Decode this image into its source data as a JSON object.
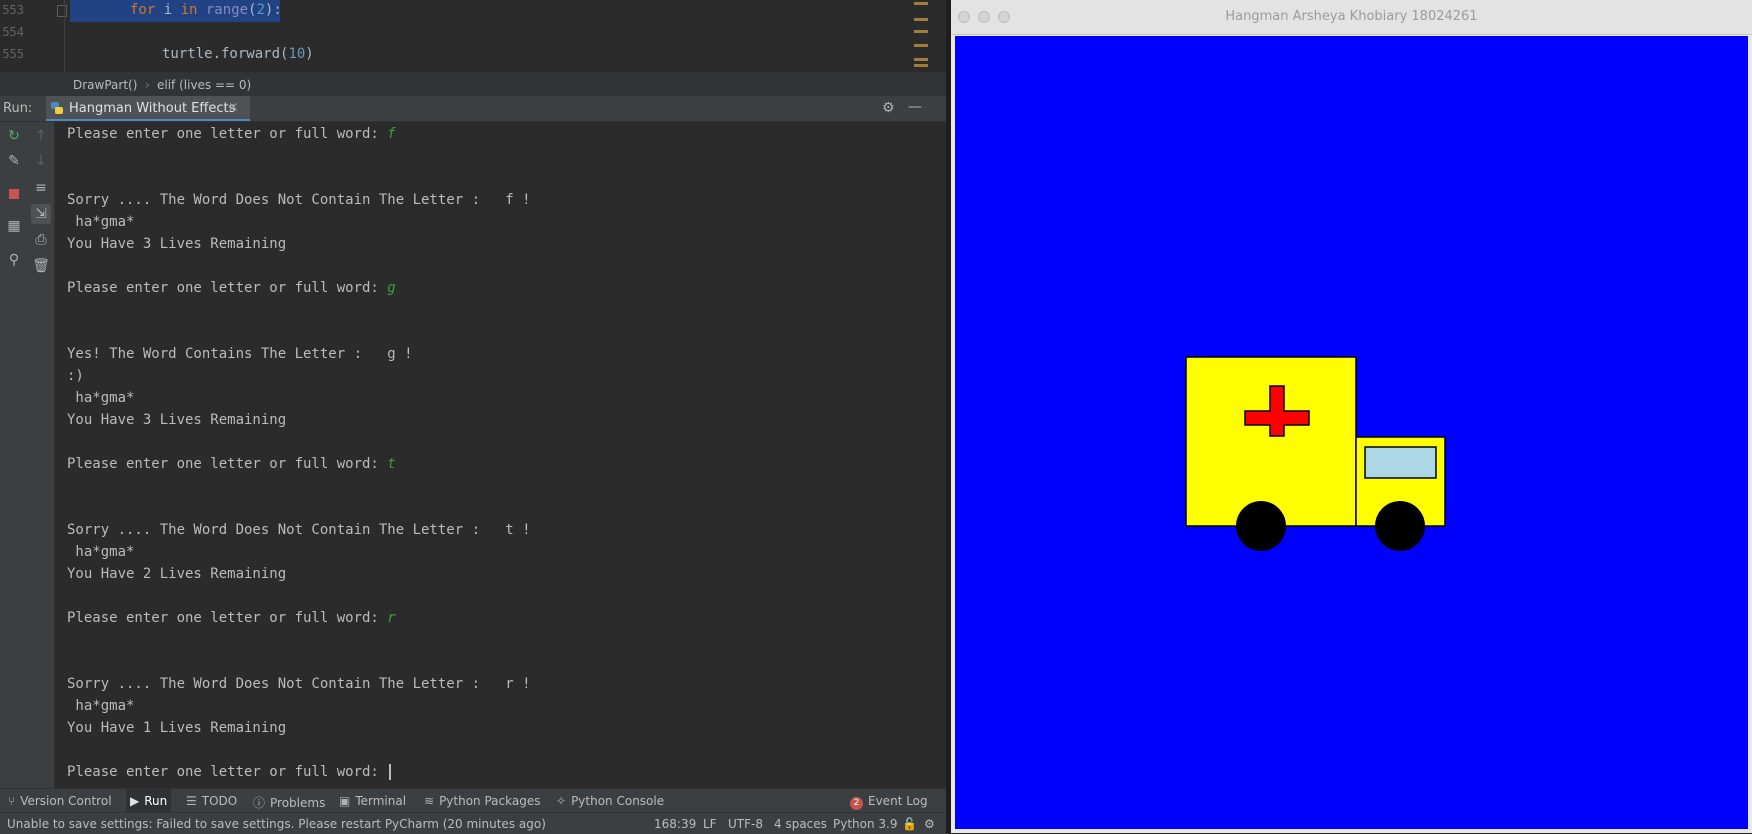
{
  "editor": {
    "gutter": [
      "553",
      "554",
      "555"
    ],
    "line1": {
      "indent": "for i in range",
      "kw_for": "for",
      "var": " i ",
      "kw_in": "in",
      "fn": " range",
      "paren_open": "(",
      "num": "2",
      "paren_close": "):"
    },
    "line3": {
      "text": "turtle.forward(",
      "num": "10",
      "close": ")"
    }
  },
  "breadcrumbs": [
    "DrawPart()",
    "elif (lives == 0)"
  ],
  "run_panel": {
    "label": "Run:",
    "tab_label": "Hangman Without Effects",
    "close": "×",
    "settings_icon": "⚙",
    "minimize_icon": "—"
  },
  "console": {
    "lines": [
      {
        "text": "Please enter one letter or full word: ",
        "input": "f"
      },
      {
        "text": ""
      },
      {
        "text": ""
      },
      {
        "text": "Sorry .... The Word Does Not Contain The Letter :   f !"
      },
      {
        "text": " ha*gma*"
      },
      {
        "text": "You Have 3 Lives Remaining"
      },
      {
        "text": ""
      },
      {
        "text": "Please enter one letter or full word: ",
        "input": "g"
      },
      {
        "text": ""
      },
      {
        "text": ""
      },
      {
        "text": "Yes! The Word Contains The Letter :   g !"
      },
      {
        "text": ":)"
      },
      {
        "text": " ha*gma*"
      },
      {
        "text": "You Have 3 Lives Remaining"
      },
      {
        "text": ""
      },
      {
        "text": "Please enter one letter or full word: ",
        "input": "t"
      },
      {
        "text": ""
      },
      {
        "text": ""
      },
      {
        "text": "Sorry .... The Word Does Not Contain The Letter :   t !"
      },
      {
        "text": " ha*gma*"
      },
      {
        "text": "You Have 2 Lives Remaining"
      },
      {
        "text": ""
      },
      {
        "text": "Please enter one letter or full word: ",
        "input": "r"
      },
      {
        "text": ""
      },
      {
        "text": ""
      },
      {
        "text": "Sorry .... The Word Does Not Contain The Letter :   r !"
      },
      {
        "text": " ha*gma*"
      },
      {
        "text": "You Have 1 Lives Remaining"
      },
      {
        "text": ""
      },
      {
        "text": "Please enter one letter or full word: ",
        "cursor": true
      }
    ]
  },
  "tool_windows": {
    "version_control": "Version Control",
    "run": "Run",
    "todo": "TODO",
    "problems": "Problems",
    "terminal": "Terminal",
    "python_packages": "Python Packages",
    "python_console": "Python Console",
    "event_log": "Event Log",
    "event_count": "2"
  },
  "status_bar": {
    "message": "Unable to save settings: Failed to save settings. Please restart PyCharm (20 minutes ago)",
    "position": "168:39",
    "line_sep": "LF",
    "encoding": "UTF-8",
    "indent": "4 spaces",
    "interpreter": "Python 3.9"
  },
  "turtle_window": {
    "title": "Hangman Arsheya Khobiary 18024261",
    "canvas_color": "#0000ff",
    "truck_color": "#ffff00",
    "cross_color": "#ff0000",
    "window_pane_color": "#add8e6",
    "wheel_color": "#000000"
  }
}
